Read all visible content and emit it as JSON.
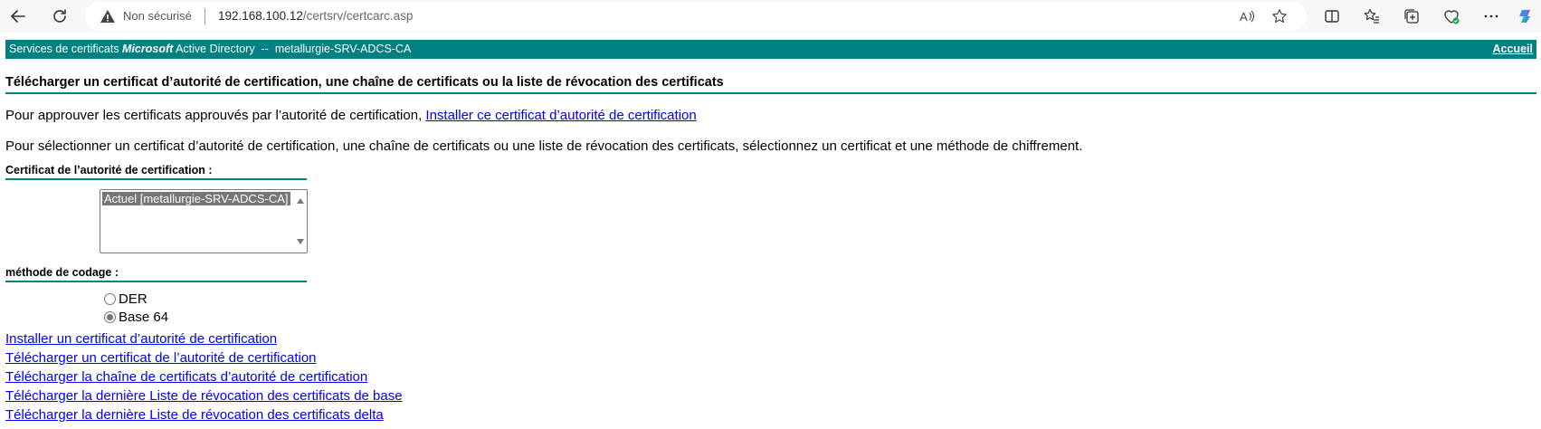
{
  "browser": {
    "security_label": "Non sécurisé",
    "url_host": "192.168.100.12",
    "url_path": "/certsrv/certcarc.asp",
    "icons": [
      "back-icon",
      "refresh-icon",
      "warning-icon",
      "read-aloud-icon",
      "favorite-star-icon",
      "split-screen-icon",
      "favorites-icon",
      "collections-icon",
      "browser-essentials-icon",
      "more-icon",
      "copilot-icon"
    ]
  },
  "header": {
    "title_prefix": "Services de certificats ",
    "title_microsoft": "Microsoft",
    "title_suffix": " Active Directory  --  metallurgie-SRV-ADCS-CA",
    "home_label": "Accueil",
    "band_color": "#008080"
  },
  "main": {
    "heading": "Télécharger un certificat d’autorité de certification, une chaîne de certificats ou la liste de révocation des certificats",
    "intro_text": "Pour approuver les certificats approuvés par l’autorité de certification, ",
    "intro_link": "Installer ce certificat d’autorité de certification",
    "instructions": "Pour sélectionner un certificat d’autorité de certification, une chaîne de certificats ou une liste de révocation des certificats, sélectionnez un certificat et une méthode de chiffrement.",
    "ca_label": "Certificat de l’autorité de certification :",
    "ca_options": [
      "Actuel [metallurgie-SRV-ADCS-CA]"
    ],
    "encoding_label": "méthode de codage :",
    "encoding_options": [
      {
        "label": "DER",
        "checked": false
      },
      {
        "label": "Base 64",
        "checked": true
      }
    ],
    "actions": [
      "Installer un certificat d’autorité de certification",
      "Télécharger un certificat de l’autorité de certification",
      "Télécharger la chaîne de certificats d’autorité de certification",
      "Télécharger la dernière Liste de révocation des certificats de base",
      "Télécharger la dernière Liste de révocation des certificats delta"
    ]
  }
}
